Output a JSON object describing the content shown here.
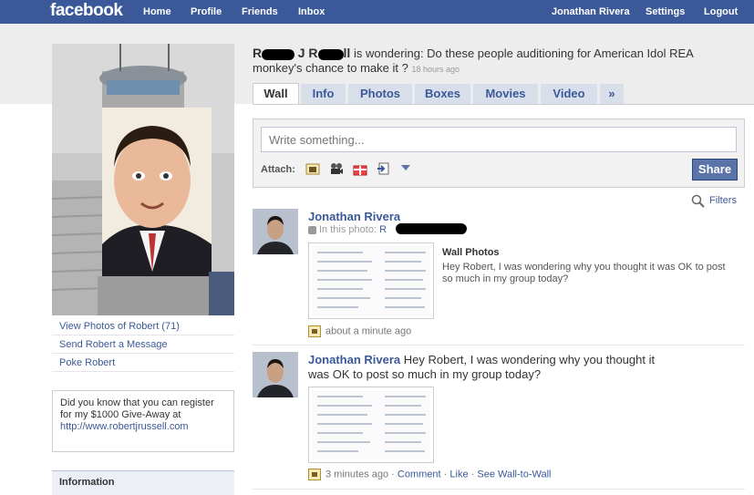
{
  "topbar": {
    "logo": "facebook",
    "nav_left": [
      "Home",
      "Profile",
      "Friends",
      "Inbox"
    ],
    "nav_right": [
      "Jonathan Rivera",
      "Settings",
      "Logout"
    ]
  },
  "colors": {
    "brand": "#3b5998",
    "link": "#3b5998",
    "share": "#5b74a8"
  },
  "profile": {
    "links": [
      "View Photos of Robert (71)",
      "Send Robert a Message",
      "Poke Robert"
    ],
    "promo": {
      "text": "Did you know that you can register for my $1000 Give-Away at",
      "url": "http://www.robertjrussell.com"
    },
    "information_heading": "Information"
  },
  "status": {
    "name_part1": "R",
    "name_part2": "J R",
    "name_part3": "ll",
    "text_line1": "is wondering: Do these people auditioning for American Idol REA",
    "text_line2": "monkey's chance to make it ?",
    "time": "18 hours ago"
  },
  "tabs": [
    "Wall",
    "Info",
    "Photos",
    "Boxes",
    "Movies",
    "Video",
    "»"
  ],
  "publisher": {
    "placeholder": "Write something...",
    "attach_label": "Attach:",
    "attach_icons": [
      "photo-icon",
      "video-icon",
      "gift-icon",
      "link-icon",
      "more-icon"
    ],
    "share_label": "Share"
  },
  "filters_label": "Filters",
  "feed": [
    {
      "poster": "Jonathan Rivera",
      "in_photo": "In this photo:",
      "in_photo_name": "R",
      "album": "Wall Photos",
      "caption": "Hey Robert, I was wondering why you thought it was OK to post so much in my group today?",
      "time": "about a minute ago"
    },
    {
      "poster": "Jonathan Rivera",
      "message_line1": "Hey Robert, I was wondering why you thought it",
      "message_line2": "was OK to post so much in my group today?",
      "time": "3 minutes ago",
      "sep": "·",
      "actions": [
        "Comment",
        "Like",
        "See Wall-to-Wall"
      ]
    }
  ]
}
